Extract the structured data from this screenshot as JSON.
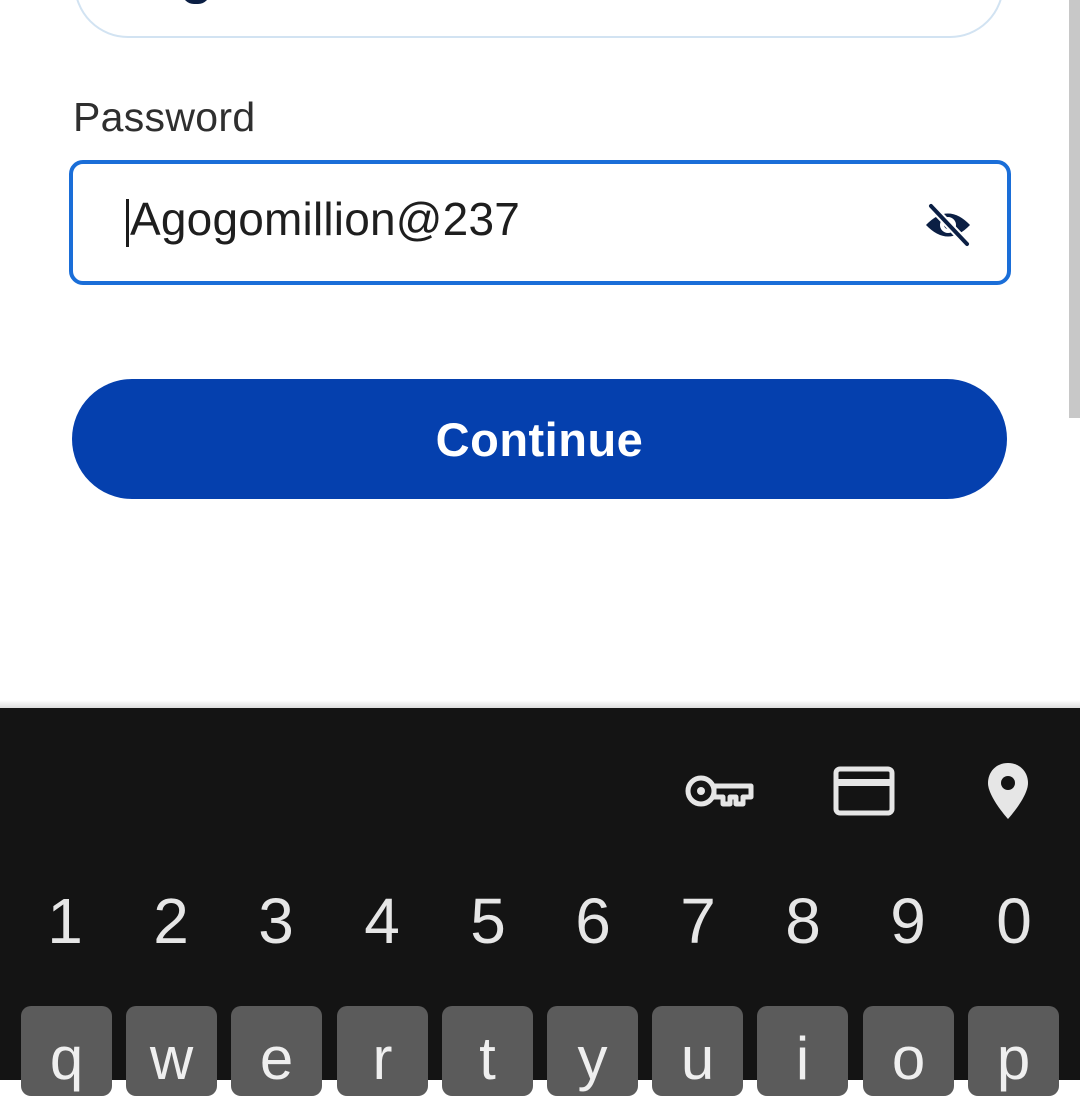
{
  "form": {
    "password_label": "Password",
    "password_value": "Agogomillion@237",
    "continue_label": "Continue"
  },
  "keyboard": {
    "toolbar": [
      "key-icon",
      "credit-card-icon",
      "location-pin-icon"
    ],
    "digits": [
      "1",
      "2",
      "3",
      "4",
      "5",
      "6",
      "7",
      "8",
      "9",
      "0"
    ],
    "letters": [
      "q",
      "w",
      "e",
      "r",
      "t",
      "y",
      "u",
      "i",
      "o",
      "p"
    ]
  },
  "colors": {
    "primary": "#0540ae",
    "focus_border": "#1a6ed8",
    "keyboard_bg": "#141414",
    "key_bg": "#5b5b5b"
  }
}
